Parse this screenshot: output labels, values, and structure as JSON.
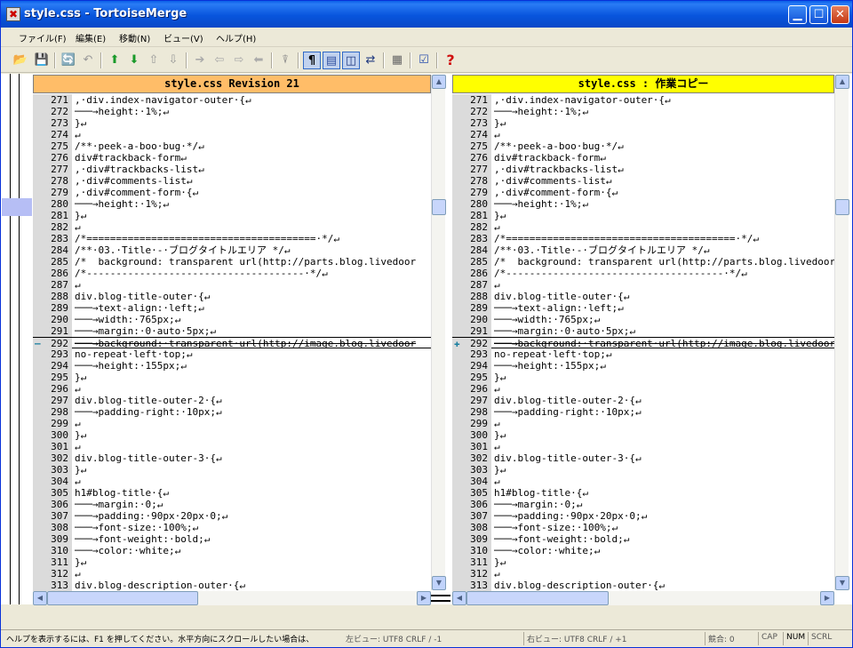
{
  "window": {
    "title": "style.css - TortoiseMerge",
    "title_icon": "✖",
    "min_glyph": "▁",
    "max_glyph": "☐",
    "close_glyph": "✕"
  },
  "menu": [
    "ファイル(F)",
    "編集(E)",
    "移動(N)",
    "ビュー(V)",
    "ヘルプ(H)"
  ],
  "toolbar": [
    {
      "icon": "open-icon",
      "glyph": "📂"
    },
    {
      "icon": "save-icon",
      "glyph": "💾"
    },
    {
      "icon": "reload-icon",
      "glyph": "🔄"
    },
    {
      "icon": "undo-icon",
      "glyph": "↶"
    },
    {
      "icon": "next-diff-icon",
      "glyph": "⬆"
    },
    {
      "icon": "prev-diff-icon",
      "glyph": "⬇"
    },
    {
      "icon": "prev-conflict-icon",
      "glyph": "⇧"
    },
    {
      "icon": "next-conflict-icon",
      "glyph": "⇩"
    },
    {
      "icon": "use-theirs-icon",
      "glyph": "➔"
    },
    {
      "icon": "use-mine-icon",
      "glyph": "⇦"
    },
    {
      "icon": "use-theirs-then-mine-icon",
      "glyph": "⇨"
    },
    {
      "icon": "use-mine-then-theirs-icon",
      "glyph": "⬅"
    },
    {
      "icon": "mark-resolved-icon",
      "glyph": "⍒"
    },
    {
      "icon": "whitespace-icon",
      "glyph": "¶"
    },
    {
      "icon": "one-pane-icon",
      "glyph": "▤"
    },
    {
      "icon": "two-pane-icon",
      "glyph": "◫"
    },
    {
      "icon": "switch-icon",
      "glyph": "⇄"
    },
    {
      "icon": "line-diff-icon",
      "glyph": "▦"
    },
    {
      "icon": "settings-icon",
      "glyph": "☑"
    },
    {
      "icon": "help-icon",
      "glyph": "?"
    }
  ],
  "left_pane": {
    "title": "style.css Revision 21",
    "header_color": "#ffbd68",
    "marker": "—"
  },
  "right_pane": {
    "title": "style.css : 作業コピー",
    "header_color": "#ffff00",
    "marker": "✚"
  },
  "lines": [
    {
      "n": "271",
      "left": ",·div.index-navigator-outer·{↵",
      "right": ",·div.index-navigator-outer·{↵"
    },
    {
      "n": "272",
      "left": "───→height:·1%;↵",
      "right": "───→height:·1%;↵"
    },
    {
      "n": "273",
      "left": "}↵",
      "right": "}↵"
    },
    {
      "n": "274",
      "left": "↵",
      "right": "↵"
    },
    {
      "n": "275",
      "left": "/**·peek-a-boo·bug·*/↵",
      "right": "/**·peek-a-boo·bug·*/↵"
    },
    {
      "n": "276",
      "left": "div#trackback-form↵",
      "right": "div#trackback-form↵"
    },
    {
      "n": "277",
      "left": ",·div#trackbacks-list↵",
      "right": ",·div#trackbacks-list↵"
    },
    {
      "n": "278",
      "left": ",·div#comments-list↵",
      "right": ",·div#comments-list↵"
    },
    {
      "n": "279",
      "left": ",·div#comment-form·{↵",
      "right": ",·div#comment-form·{↵"
    },
    {
      "n": "280",
      "left": "───→height:·1%;↵",
      "right": "───→height:·1%;↵"
    },
    {
      "n": "281",
      "left": "}↵",
      "right": "}↵"
    },
    {
      "n": "282",
      "left": "↵",
      "right": "↵"
    },
    {
      "n": "283",
      "left": "/*=======================================·*/↵",
      "right": "/*=======================================·*/↵"
    },
    {
      "n": "284",
      "left": "/**·03.·Title·-·ブログタイトルエリア *∕↵",
      "right": "/**·03.·Title·-·ブログタイトルエリア *∕↵"
    },
    {
      "n": "285",
      "left": "/*  background: transparent url(http://parts.blog.livedoor",
      "right": "/*  background: transparent url(http://parts.blog.livedoor"
    },
    {
      "n": "286",
      "left": "/*-------------------------------------·*/↵",
      "right": "/*-------------------------------------·*/↵"
    },
    {
      "n": "287",
      "left": "↵",
      "right": "↵"
    },
    {
      "n": "288",
      "left": "div.blog-title-outer·{↵",
      "right": "div.blog-title-outer·{↵"
    },
    {
      "n": "289",
      "left": "───→text-align:·left;↵",
      "right": "───→text-align:·left;↵"
    },
    {
      "n": "290",
      "left": "───→width:·765px;↵",
      "right": "───→width:·765px;↵"
    },
    {
      "n": "291",
      "left": "───→margin:·0·auto·5px;↵",
      "right": "───→margin:·0·auto·5px;↵"
    },
    {
      "n": "292",
      "left": "───→background:·transparent·url(http://image.blog.livedoor",
      "right": "───→background:·transparent·url(http://image.blog.livedoor",
      "changed": true
    },
    {
      "n": "293",
      "left": "no-repeat·left·top;↵",
      "right": "no-repeat·left·top;↵"
    },
    {
      "n": "294",
      "left": "───→height:·155px;↵",
      "right": "───→height:·155px;↵"
    },
    {
      "n": "295",
      "left": "}↵",
      "right": "}↵"
    },
    {
      "n": "296",
      "left": "↵",
      "right": "↵"
    },
    {
      "n": "297",
      "left": "div.blog-title-outer-2·{↵",
      "right": "div.blog-title-outer-2·{↵"
    },
    {
      "n": "298",
      "left": "───→padding-right:·10px;↵",
      "right": "───→padding-right:·10px;↵"
    },
    {
      "n": "299",
      "left": "↵",
      "right": "↵"
    },
    {
      "n": "300",
      "left": "}↵",
      "right": "}↵"
    },
    {
      "n": "301",
      "left": "↵",
      "right": "↵"
    },
    {
      "n": "302",
      "left": "div.blog-title-outer-3·{↵",
      "right": "div.blog-title-outer-3·{↵"
    },
    {
      "n": "303",
      "left": "}↵",
      "right": "}↵"
    },
    {
      "n": "304",
      "left": "↵",
      "right": "↵"
    },
    {
      "n": "305",
      "left": "h1#blog-title·{↵",
      "right": "h1#blog-title·{↵"
    },
    {
      "n": "306",
      "left": "───→margin:·0;↵",
      "right": "───→margin:·0;↵"
    },
    {
      "n": "307",
      "left": "───→padding:·90px·20px·0;↵",
      "right": "───→padding:·90px·20px·0;↵"
    },
    {
      "n": "308",
      "left": "───→font-size:·100%;↵",
      "right": "───→font-size:·100%;↵"
    },
    {
      "n": "309",
      "left": "───→font-weight:·bold;↵",
      "right": "───→font-weight:·bold;↵"
    },
    {
      "n": "310",
      "left": "───→color:·white;↵",
      "right": "───→color:·white;↵"
    },
    {
      "n": "311",
      "left": "}↵",
      "right": "}↵"
    },
    {
      "n": "312",
      "left": "↵",
      "right": "↵"
    },
    {
      "n": "313",
      "left": "div.blog-description-outer·{↵",
      "right": "div.blog-description-outer·{↵"
    }
  ],
  "status": {
    "help": "ヘルプを表示するには、F1 を押してください。水平方向にスクロールしたい場合は、",
    "left_view": "左ビュー: UTF8 CRLF / -1",
    "right_view": "右ビュー: UTF8 CRLF / +1",
    "conflicts": "競合: 0",
    "cap": "CAP",
    "num": "NUM",
    "scrl": "SCRL"
  },
  "colors": {
    "changed_left": "#000000",
    "locator_mark": "#b6bef5"
  }
}
